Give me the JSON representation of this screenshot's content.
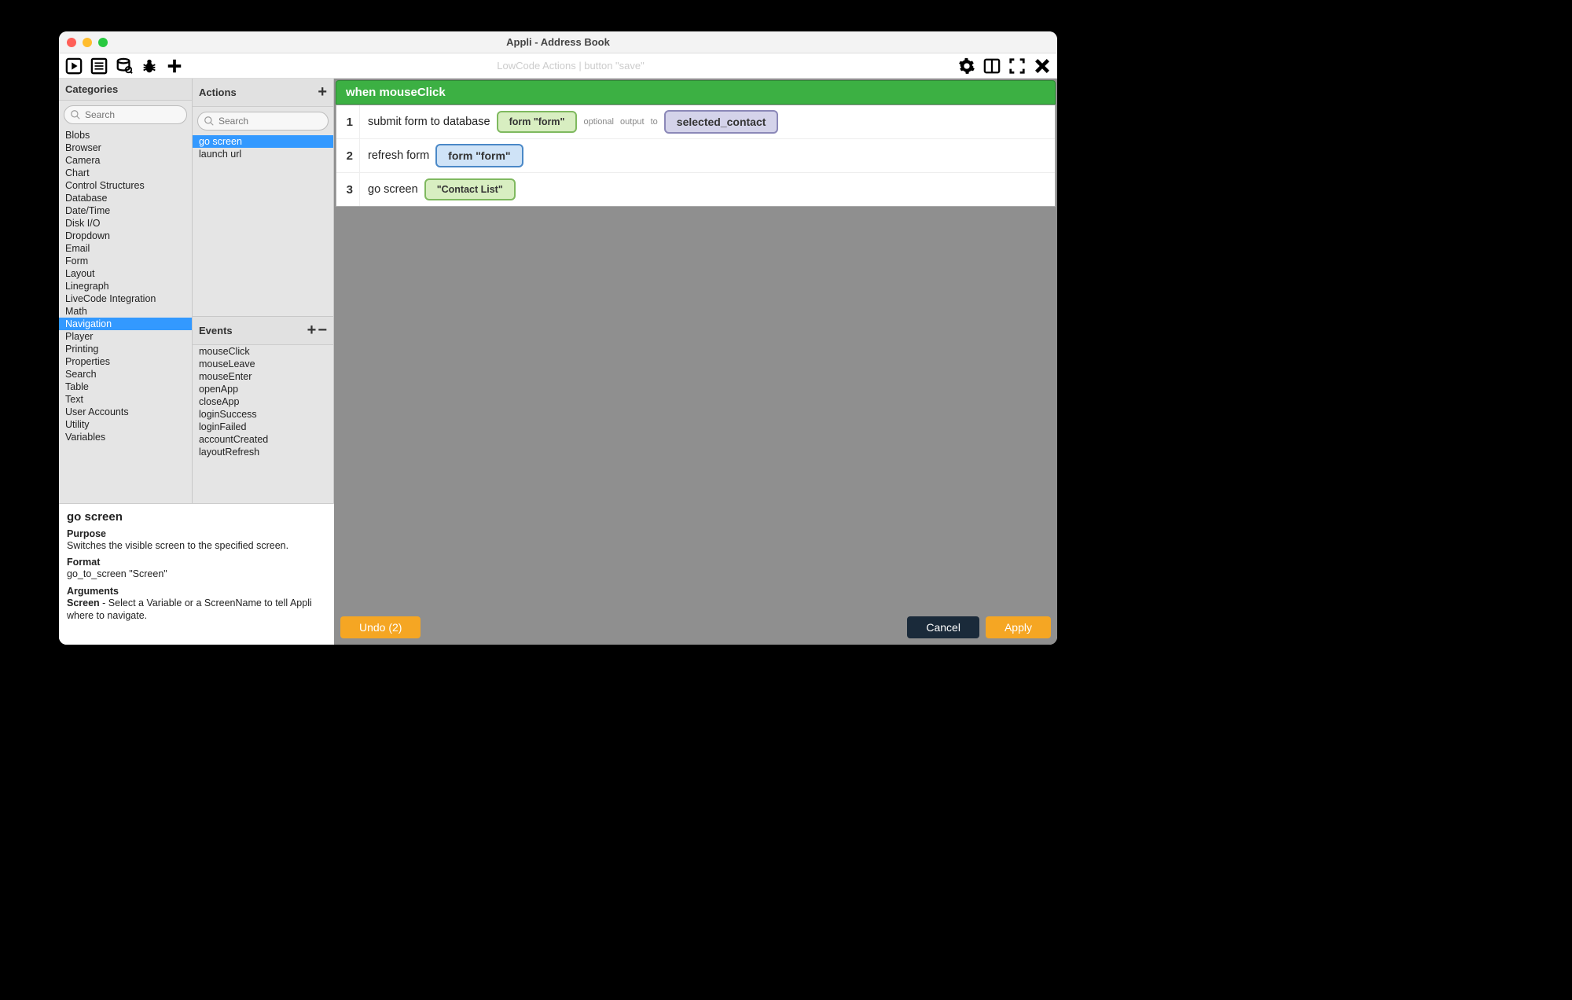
{
  "window": {
    "title": "Appli - Address Book"
  },
  "toolbar": {
    "subtitle": "LowCode Actions | button \"save\""
  },
  "categories": {
    "title": "Categories",
    "search_placeholder": "Search",
    "items": [
      "Blobs",
      "Browser",
      "Camera",
      "Chart",
      "Control Structures",
      "Database",
      "Date/Time",
      "Disk I/O",
      "Dropdown",
      "Email",
      "Form",
      "Layout",
      "Linegraph",
      "LiveCode Integration",
      "Math",
      "Navigation",
      "Player",
      "Printing",
      "Properties",
      "Search",
      "Table",
      "Text",
      "User Accounts",
      "Utility",
      "Variables"
    ],
    "selected": "Navigation"
  },
  "actions": {
    "title": "Actions",
    "search_placeholder": "Search",
    "items": [
      "go screen",
      "launch url"
    ],
    "selected": "go screen"
  },
  "events": {
    "title": "Events",
    "items": [
      "mouseClick",
      "mouseLeave",
      "mouseEnter",
      "openApp",
      "closeApp",
      "loginSuccess",
      "loginFailed",
      "accountCreated",
      "layoutRefresh"
    ]
  },
  "info": {
    "name": "go screen",
    "purpose_h": "Purpose",
    "purpose": "Switches the visible screen to the specified screen.",
    "format_h": "Format",
    "format": "go_to_screen \"Screen\"",
    "arguments_h": "Arguments",
    "arg_name": "Screen",
    "arg_desc": " - Select a Variable or a ScreenName to tell Appli where to navigate."
  },
  "flow": {
    "event_label": "when mouseClick",
    "steps": [
      {
        "n": "1",
        "text": "submit form to database",
        "chip1": "form \"form\"",
        "chip1_style": "green",
        "opt1": "optional",
        "opt2": "output",
        "opt3": "to",
        "chip2": "selected_contact",
        "chip2_style": "purple"
      },
      {
        "n": "2",
        "text": "refresh form",
        "chip1": "form \"form\"",
        "chip1_style": "blue"
      },
      {
        "n": "3",
        "text": "go screen",
        "chip1": "\"Contact List\"",
        "chip1_style": "green"
      }
    ]
  },
  "buttons": {
    "undo": "Undo (2)",
    "cancel": "Cancel",
    "apply": "Apply"
  }
}
